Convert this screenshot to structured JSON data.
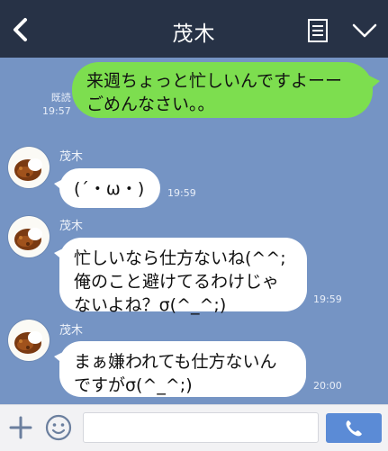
{
  "header": {
    "title": "茂木",
    "back_icon": "chevron-left-icon",
    "notes_icon": "notes-icon",
    "menu_icon": "chevron-down-icon"
  },
  "messages": [
    {
      "direction": "outgoing",
      "text": "来週ちょっと忙しいんですよーー\nごめんなさい。。",
      "read_label": "既読",
      "time": "19:57"
    },
    {
      "direction": "incoming",
      "sender": "茂木",
      "text": "(´・ω・)",
      "time": "19:59"
    },
    {
      "direction": "incoming",
      "sender": "茂木",
      "text": "忙しいなら仕方ないね(^^;\n俺のこと避けてるわけじゃ\nないよね？σ(^_^;)",
      "time": "19:59"
    },
    {
      "direction": "incoming",
      "sender": "茂木",
      "text": "まぁ嫌われても仕方ないん\nですがσ(^_^;)",
      "time": "20:00"
    }
  ],
  "input_bar": {
    "plus_icon": "plus-icon",
    "emoji_icon": "emoji-icon",
    "message_value": "",
    "call_icon": "phone-icon"
  },
  "colors": {
    "header_bg": "#273246",
    "chat_bg": "#7594c4",
    "outgoing_bubble": "#7dde4f",
    "incoming_bubble": "#ffffff",
    "call_button": "#5b8bd6"
  }
}
